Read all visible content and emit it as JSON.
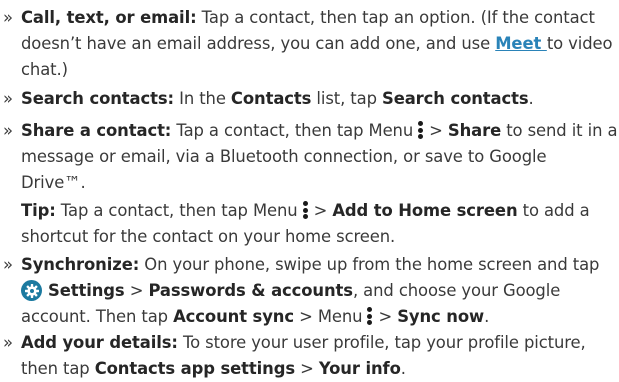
{
  "bullet": "»",
  "items": [
    {
      "lines": [
        {
          "bold": "Call, text, or email:",
          "t1": " Tap a contact, then tap an option. (If the contact"
        },
        {
          "t1": "doesn’t have an email address, you can add one, and use ",
          "link": "Meet ",
          "t2": "to video"
        },
        {
          "t1": "chat.)"
        }
      ]
    },
    {
      "lines": [
        {
          "bold": "Search contacts:",
          "t1": " In the ",
          "b2": "Contacts",
          "t2": " list, tap ",
          "b3": "Search contacts",
          "t3": "."
        }
      ]
    },
    {
      "lines": [
        {
          "bold": "Share a contact:",
          "t1": " Tap a contact, then tap Menu",
          "t2": "> ",
          "b2": "Share",
          "t3": " to send it in a"
        },
        {
          "t1": "message or email, via a Bluetooth connection, or save to Google"
        },
        {
          "t1": "Drive™."
        }
      ]
    },
    {
      "lines": [
        {
          "bold": "Tip:",
          "t1": " Tap a contact, then tap Menu",
          "t2": "> ",
          "b2": "Add to Home screen",
          "t3": " to add a"
        },
        {
          "t1": "shortcut for the contact on your home screen."
        }
      ]
    },
    {
      "lines": [
        {
          "bold": "Synchronize:",
          "t1": " On your phone, swipe up from the home screen and tap"
        },
        {
          "b1": "Settings",
          "t1": " > ",
          "b2": "Passwords & accounts",
          "t2": ", and choose your Google"
        },
        {
          "t1": "account. Then tap ",
          "b1": "Account sync",
          "t2": " > Menu",
          "t3": "> ",
          "b2": "Sync now",
          "t4": "."
        }
      ]
    },
    {
      "lines": [
        {
          "bold": "Add your details:",
          "t1": " To store your user profile, tap your profile picture,"
        },
        {
          "t1": "then tap ",
          "b1": "Contacts app settings",
          "t2": " > ",
          "b2": "Your info",
          "t3": "."
        }
      ]
    }
  ],
  "icons": {
    "menu": "menu-kebab-icon",
    "settings": "settings-gear-icon"
  },
  "colors": {
    "text": "#3a3a3a",
    "link": "#2a83b8",
    "settings_icon": "#1c7aa0"
  }
}
